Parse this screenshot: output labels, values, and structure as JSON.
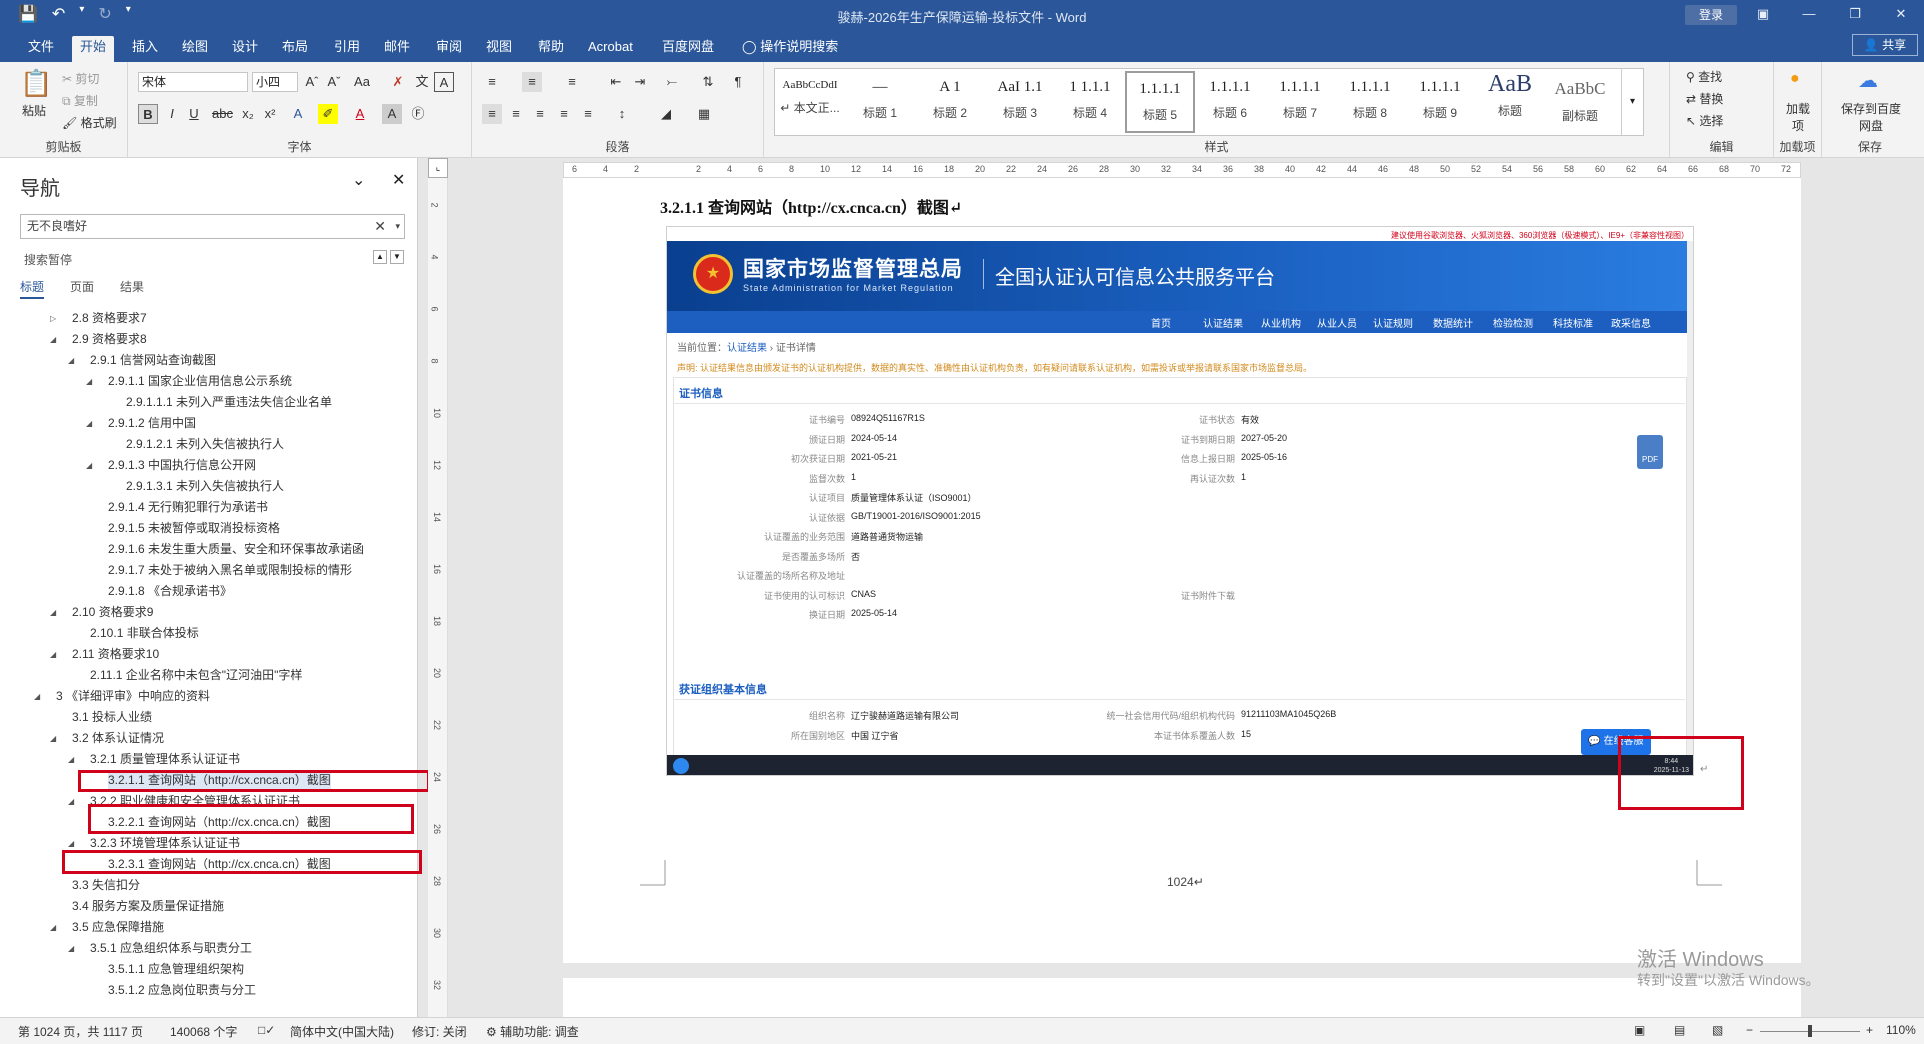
{
  "window": {
    "title": "骏赫-2026年生产保障运输-投标文件 - Word",
    "login": "登录",
    "share": "共享"
  },
  "qat": {
    "save_icon": "save-icon",
    "undo_icon": "undo-icon",
    "redo_icon": "redo-icon"
  },
  "tabs": [
    "文件",
    "开始",
    "插入",
    "绘图",
    "设计",
    "布局",
    "引用",
    "邮件",
    "审阅",
    "视图",
    "帮助",
    "Acrobat",
    "百度网盘"
  ],
  "tell_me": "操作说明搜索",
  "ribbon": {
    "clipboard": {
      "paste": "粘贴",
      "cut": "剪切",
      "copy": "复制",
      "format_painter": "格式刷",
      "label": "剪贴板"
    },
    "font": {
      "name": "宋体",
      "size": "小四",
      "label": "字体"
    },
    "paragraph": {
      "label": "段落"
    },
    "styles": {
      "label": "样式",
      "items": [
        {
          "preview": "AaBbCcDdI",
          "name": "↵ 本文正..."
        },
        {
          "preview": "—",
          "name": "标题 1"
        },
        {
          "preview": "A 1",
          "name": "标题 2"
        },
        {
          "preview": "AaI 1.1",
          "name": "标题 3"
        },
        {
          "preview": "1 1.1.1",
          "name": "标题 4"
        },
        {
          "preview": "1.1.1.1",
          "name": "标题 5"
        },
        {
          "preview": "1.1.1.1",
          "name": "标题 6"
        },
        {
          "preview": "1.1.1.1",
          "name": "标题 7"
        },
        {
          "preview": "1.1.1.1",
          "name": "标题 8"
        },
        {
          "preview": "1.1.1.1",
          "name": "标题 9"
        },
        {
          "preview": "AaB",
          "name": "标题"
        },
        {
          "preview": "AaBbC",
          "name": "副标题"
        }
      ]
    },
    "editing": {
      "find": "查找",
      "replace": "替换",
      "select": "选择",
      "label": "编辑"
    },
    "addins": {
      "add": "加载项",
      "label": "加载项"
    },
    "save_baidu": {
      "btn": "保存到百度网盘",
      "label": "保存"
    }
  },
  "nav": {
    "title": "导航",
    "search_value": "无不良嗜好",
    "paused": "搜索暂停",
    "tabs": [
      "标题",
      "页面",
      "结果"
    ],
    "items": [
      {
        "text": "2.8 资格要求7",
        "toggle": "▷"
      },
      {
        "text": "2.9 资格要求8",
        "toggle": "◢"
      },
      {
        "text": "2.9.1 信誉网站查询截图",
        "toggle": "◢"
      },
      {
        "text": "2.9.1.1 国家企业信用信息公示系统",
        "toggle": "◢"
      },
      {
        "text": "2.9.1.1.1 未列入严重违法失信企业名单",
        "toggle": ""
      },
      {
        "text": "2.9.1.2 信用中国",
        "toggle": "◢"
      },
      {
        "text": "2.9.1.2.1 未列入失信被执行人",
        "toggle": ""
      },
      {
        "text": "2.9.1.3 中国执行信息公开网",
        "toggle": "◢"
      },
      {
        "text": "2.9.1.3.1 未列入失信被执行人",
        "toggle": ""
      },
      {
        "text": "2.9.1.4 无行贿犯罪行为承诺书",
        "toggle": ""
      },
      {
        "text": "2.9.1.5 未被暂停或取消投标资格",
        "toggle": ""
      },
      {
        "text": "2.9.1.6 未发生重大质量、安全和环保事故承诺函",
        "toggle": ""
      },
      {
        "text": "2.9.1.7 未处于被纳入黑名单或限制投标的情形",
        "toggle": ""
      },
      {
        "text": "2.9.1.8 《合规承诺书》",
        "toggle": ""
      },
      {
        "text": "2.10 资格要求9",
        "toggle": "◢"
      },
      {
        "text": "2.10.1 非联合体投标",
        "toggle": ""
      },
      {
        "text": "2.11 资格要求10",
        "toggle": "◢"
      },
      {
        "text": "2.11.1 企业名称中未包含\"辽河油田\"字样",
        "toggle": ""
      },
      {
        "text": "3 《详细评审》中响应的资料",
        "toggle": "◢"
      },
      {
        "text": "3.1 投标人业绩",
        "toggle": ""
      },
      {
        "text": "3.2 体系认证情况",
        "toggle": "◢"
      },
      {
        "text": "3.2.1 质量管理体系认证证书",
        "toggle": "◢"
      },
      {
        "text": "3.2.1.1 查询网站（http://cx.cnca.cn）截图",
        "toggle": ""
      },
      {
        "text": "3.2.2 职业健康和安全管理体系认证证书",
        "toggle": "◢"
      },
      {
        "text": "3.2.2.1 查询网站（http://cx.cnca.cn）截图",
        "toggle": ""
      },
      {
        "text": "3.2.3 环境管理体系认证证书",
        "toggle": "◢"
      },
      {
        "text": "3.2.3.1 查询网站（http://cx.cnca.cn）截图",
        "toggle": ""
      },
      {
        "text": "3.3 失信扣分",
        "toggle": ""
      },
      {
        "text": "3.4 服务方案及质量保证措施",
        "toggle": ""
      },
      {
        "text": "3.5 应急保障措施",
        "toggle": "◢"
      },
      {
        "text": "3.5.1 应急组织体系与职责分工",
        "toggle": "◢"
      },
      {
        "text": "3.5.1.1 应急管理组织架构",
        "toggle": ""
      },
      {
        "text": "3.5.1.2 应急岗位职责与分工",
        "toggle": ""
      }
    ]
  },
  "ruler": {
    "h_ticks": [
      "6",
      "4",
      "2",
      "",
      "2",
      "4",
      "6",
      "8",
      "10",
      "12",
      "14",
      "16",
      "18",
      "20",
      "22",
      "24",
      "26",
      "28",
      "30",
      "32",
      "34",
      "36",
      "38",
      "40",
      "42",
      "44",
      "46",
      "48",
      "50",
      "52",
      "54",
      "56",
      "58",
      "60",
      "62",
      "64",
      "66",
      "68",
      "70",
      "72"
    ],
    "v_ticks": [
      "2",
      "4",
      "6",
      "8",
      "10",
      "12",
      "14",
      "16",
      "18",
      "20",
      "22",
      "24",
      "26",
      "28",
      "30",
      "32"
    ]
  },
  "doc": {
    "heading": "3.2.1.1 查询网站（http://cx.cnca.cn）截图↵",
    "page_number": "1024↵",
    "shot": {
      "warning": "建议使用谷歌浏览器、火狐浏览器、360浏览器（极速模式）、IE9+（非兼容性视图）",
      "org_cn": "国家市场监督管理总局",
      "org_en": "State Administration  for  Market Regulation",
      "platform": "全国认证认可信息公共服务平台",
      "nav": [
        "首页",
        "认证结果",
        "从业机构",
        "从业人员",
        "认证规则",
        "数据统计",
        "检验检测",
        "科技标准",
        "政采信息"
      ],
      "crumb_prefix": "当前位置：",
      "crumb_1": "认证结果",
      "crumb_2": "证书详情",
      "notice": "声明: 认证结果信息由颁发证书的认证机构提供，数据的真实性、准确性由认证机构负责，如有疑问请联系认证机构，如需投诉或举报请联系国家市场监督总局。",
      "section1": "证书信息",
      "left_fields": [
        {
          "label": "证书编号",
          "value": "08924Q51167R1S"
        },
        {
          "label": "颁证日期",
          "value": "2024-05-14"
        },
        {
          "label": "初次获证日期",
          "value": "2021-05-21"
        },
        {
          "label": "监督次数",
          "value": "1"
        },
        {
          "label": "认证项目",
          "value": "质量管理体系认证（ISO9001）"
        },
        {
          "label": "认证依据",
          "value": "GB/T19001-2016/ISO9001:2015"
        },
        {
          "label": "认证覆盖的业务范围",
          "value": "道路普通货物运输"
        },
        {
          "label": "是否覆盖多场所",
          "value": "否"
        },
        {
          "label": "认证覆盖的场所名称及地址",
          "value": ""
        },
        {
          "label": "证书使用的认可标识",
          "value": "CNAS"
        },
        {
          "label": "换证日期",
          "value": "2025-05-14"
        }
      ],
      "right_fields": [
        {
          "label": "证书状态",
          "value": "有效"
        },
        {
          "label": "证书到期日期",
          "value": "2027-05-20"
        },
        {
          "label": "信息上报日期",
          "value": "2025-05-16"
        },
        {
          "label": "再认证次数",
          "value": "1"
        },
        {
          "label": "证书附件下载",
          "value": ""
        }
      ],
      "section2": "获证组织基本信息",
      "org_fields": [
        {
          "label": "组织名称",
          "value": "辽宁骏赫道路运输有限公司"
        },
        {
          "label": "所在国别地区",
          "value": "中国 辽宁省"
        }
      ],
      "org_right_fields": [
        {
          "label": "统一社会信用代码/组织机构代码",
          "value": "91211103MA1045Q26B"
        },
        {
          "label": "本证书体系覆盖人数",
          "value": "15"
        }
      ],
      "online": "在线客服",
      "pdf": "PDF",
      "time": "8:44",
      "date": "2025-11-13"
    }
  },
  "watermark": {
    "line1": "激活 Windows",
    "line2": "转到\"设置\"以激活 Windows。"
  },
  "status": {
    "page": "第 1024 页，共 1117 页",
    "words": "140068 个字",
    "lang": "简体中文(中国大陆)",
    "track": "修订: 关闭",
    "access": "辅助功能: 调查",
    "zoom": "110%"
  }
}
